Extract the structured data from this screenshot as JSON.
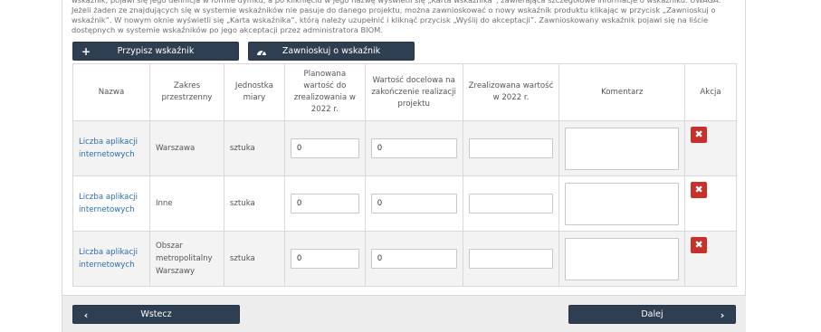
{
  "intro": {
    "text": "wskaźnik, pojawi się jego definicja w formie dymku, a po kliknięciu w jego nazwę wyświetli się „Karta wskaźnika”, zawierająca szczegółowe informacje o wskaźniku. UWAGA: Jeżeli żaden ze znajdujących się w systemie wskaźników nie pasuje do danego projektu, można zawnioskować o nowy wskaźnik produktu klikając w przycisk „Zawnioskuj o wskaźnik”. W nowym oknie wyświetli się „Karta wskaźnika”, którą należy uzupełnić i kliknąć przycisk „Wyślij do akceptacji”. Zawnioskowany wskaźnik pojawi się na liście dostępnych w systemie wskaźników po jego akceptacji przez administratora BIOM."
  },
  "toolbar": {
    "assign_label": "Przypisz wskaźnik",
    "assign_icon": "plus-icon",
    "request_label": "Zawnioskuj o wskaźnik",
    "request_icon": "gauge-icon"
  },
  "table": {
    "headers": {
      "name": "Nazwa",
      "scope": "Zakres przestrzenny",
      "unit": "Jednostka miary",
      "planned": "Planowana wartość do zrealizowania w 2022 r.",
      "target": "Wartość docelowa na zakończenie realizacji projektu",
      "realized": "Zrealizowana wartość w 2022 r.",
      "comment": "Komentarz",
      "action": "Akcja"
    },
    "rows": [
      {
        "name": "Liczba aplikacji internetowych",
        "scope": "Warszawa",
        "unit": "sztuka",
        "planned": "0",
        "target": "0",
        "realized": "",
        "comment": ""
      },
      {
        "name": "Liczba aplikacji internetowych",
        "scope": "Inne",
        "unit": "sztuka",
        "planned": "0",
        "target": "0",
        "realized": "",
        "comment": ""
      },
      {
        "name": "Liczba aplikacji internetowych",
        "scope": "Obszar metropolitalny Warszawy",
        "unit": "sztuka",
        "planned": "0",
        "target": "0",
        "realized": "",
        "comment": ""
      }
    ],
    "delete_icon": "x-icon"
  },
  "nav": {
    "back_label": "Wstecz",
    "next_label": "Dalej",
    "back_icon": "chevron-left-icon",
    "next_icon": "chevron-right-icon"
  },
  "colors": {
    "button_dark": "#2f3f52",
    "link": "#2b6cb0",
    "delete": "#c9302c"
  }
}
